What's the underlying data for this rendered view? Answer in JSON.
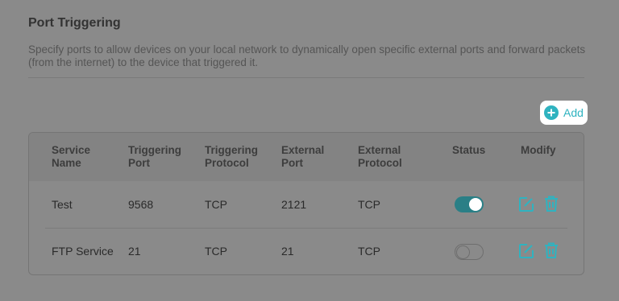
{
  "page": {
    "title": "Port Triggering",
    "description": "Specify ports to allow devices on your local network to dynamically open specific external ports and forward packets (from the internet) to the device that triggered it."
  },
  "toolbar": {
    "add_label": "Add",
    "add_icon": "plus-circle-icon"
  },
  "table": {
    "headers": {
      "service_name": "Service\nName",
      "triggering_port": "Triggering\nPort",
      "triggering_protocol": "Triggering\nProtocol",
      "external_port": "External\nPort",
      "external_protocol": "External\nProtocol",
      "status": "Status",
      "modify": "Modify"
    },
    "rows": [
      {
        "service_name": "Test",
        "triggering_port": "9568",
        "triggering_protocol": "TCP",
        "external_port": "2121",
        "external_protocol": "TCP",
        "status_enabled": true
      },
      {
        "service_name": "FTP Service",
        "triggering_port": "21",
        "triggering_protocol": "TCP",
        "external_port": "21",
        "external_protocol": "TCP",
        "status_enabled": false
      }
    ]
  },
  "colors": {
    "accent": "#2fb3c0",
    "toggle_on": "#2a7f86",
    "overlay_background": "#8a8a8a"
  }
}
